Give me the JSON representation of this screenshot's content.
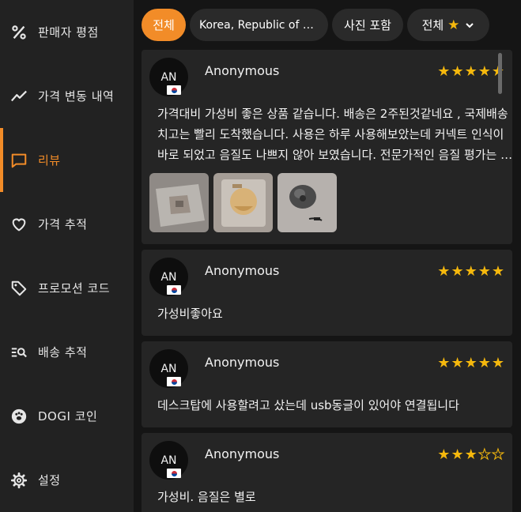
{
  "sidebar": {
    "items": [
      {
        "label": "판매자 평점",
        "icon": "percent-icon"
      },
      {
        "label": "가격 변동 내역",
        "icon": "trend-icon"
      },
      {
        "label": "리뷰",
        "icon": "chat-icon"
      },
      {
        "label": "가격 추적",
        "icon": "heart-icon"
      },
      {
        "label": "프로모션 코드",
        "icon": "tag-icon"
      },
      {
        "label": "배송 추적",
        "icon": "track-search-icon"
      },
      {
        "label": "DOGI 코인",
        "icon": "paw-icon"
      },
      {
        "label": "설정",
        "icon": "gear-icon"
      }
    ],
    "active_index": 2
  },
  "filters": {
    "all_label": "전체",
    "country_label": "Korea, Republic of Korea",
    "photo_label": "사진 포함",
    "rating_label": "전체"
  },
  "colors": {
    "accent": "#f28c28",
    "star": "#f5b80d"
  },
  "reviews": [
    {
      "initials": "AN",
      "author": "Anonymous",
      "rating": 5,
      "text": "가격대비 가성비 좋은 상품 같습니다. 배송은 2주된것같네요 , 국제배송 치고는 빨리 도착했습니다. 사용은 하루 사용해보았는데 커넥트 인식이 바로 되었고 음질도 나쁘지 않아 보였습니다. 전문가적인 음질 평가는 어렵지만 만족합니다.",
      "photos": [
        "photo-1",
        "photo-2",
        "photo-3"
      ]
    },
    {
      "initials": "AN",
      "author": "Anonymous",
      "rating": 5,
      "text": "가성비좋아요"
    },
    {
      "initials": "AN",
      "author": "Anonymous",
      "rating": 5,
      "text": "데스크탑에 사용할려고 샀는데 usb동글이 있어야 연결됩니다"
    },
    {
      "initials": "AN",
      "author": "Anonymous",
      "rating": 3,
      "text": "가성비. 음질은 별로"
    }
  ]
}
